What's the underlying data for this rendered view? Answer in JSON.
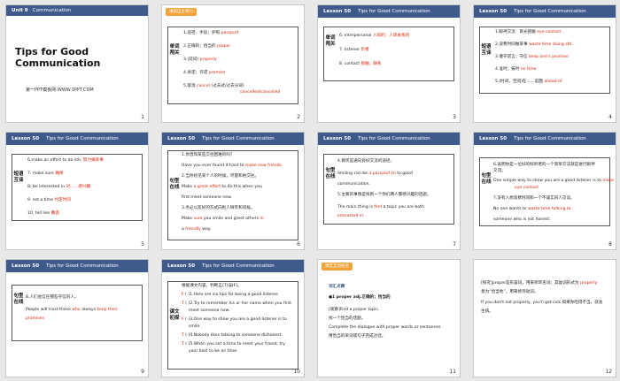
{
  "slides": [
    {
      "num": "1",
      "unit": "Unit 9",
      "header": "Communication",
      "title": "Tips for Good Communication",
      "site": "第一PPT模板网-WWW.1PPT.COM"
    },
    {
      "num": "2",
      "tag": "课前自主预习",
      "lesson": "Lesson 50",
      "header": "Tips for Good Communication",
      "side": "单词闯关",
      "lines": [
        "1.途径、手段；护照",
        "2.正确的；恰当的",
        "3.(前词)",
        "4.承诺；许诺",
        "5.取消",
        "(过去式/过去分词)"
      ],
      "answers": [
        "passport",
        "proper",
        "properly",
        "promise",
        "cancel",
        "cancelled/cancelled"
      ]
    },
    {
      "num": "3",
      "lesson": "Lesson 50",
      "header": "Tips for Good Communication",
      "side": "单词闯关",
      "lines": [
        "6.  interpersonal",
        "7.  listener",
        "8.  contact"
      ],
      "answers": [
        "人际的；人际关系的",
        "听者",
        "接触；联系"
      ]
    },
    {
      "num": "4",
      "lesson": "Lesson 50",
      "header": "Tips for Good Communication",
      "side": "短语互译",
      "lines": [
        "1.眼神交流：目光接触",
        "2.浪费时间做某事",
        "3.遵守诺言；守信",
        "4.准时；按时",
        "5.(时间、空间)在……前面"
      ],
      "answers": [
        "eye contact",
        "waste time doing sth.",
        "keep one's promise",
        "on time",
        "ahead of"
      ]
    },
    {
      "num": "5",
      "lesson": "Lesson 50",
      "header": "Tips for Good Communication",
      "side": "短语互译",
      "lines": [
        "6.make an effort to do sth.",
        "7.  make sure",
        "8.  be interested in",
        "9.  set a time",
        "10.  tell lies"
      ],
      "answers": [
        "努力做某事",
        "确保",
        "对……感兴趣",
        "约定时间",
        "撒谎"
      ]
    },
    {
      "num": "6",
      "lesson": "Lesson 50",
      "header": "Tips for Good Communication",
      "side": "句型在线",
      "lines": [
        "1.你曾和某些交往困难的吗？",
        "Have you ever found it hard to",
        "2.当你初见某个人的时候，尽量和他交往。",
        "Make",
        "to do this when you",
        "first meet someone new.",
        "3.务必以友好的方式向别人微笑和问候。",
        "Make",
        "you smile and greet others",
        "a",
        "way."
      ],
      "answers": [
        "make",
        "new",
        "friends",
        "a",
        "great",
        "effort",
        "sure",
        "in",
        "friendly"
      ]
    },
    {
      "num": "7",
      "lesson": "Lesson 50",
      "header": "Tips for Good Communication",
      "side": "句型在线",
      "lines": [
        "4.微笑是通向良好交流的途径。",
        "Smiling can be",
        "to good",
        "communication.",
        "5.主要的事情是找到一个你们两人都感兴趣的话题。",
        "The main thing is",
        "a topic you are both"
      ],
      "answers": [
        "a",
        "passport",
        "to",
        "find",
        "interested",
        "in"
      ]
    },
    {
      "num": "8",
      "lesson": "Lesson 50",
      "header": "Tips for Good Communication",
      "side": "句型在线",
      "lines": [
        "6.表明你是一位好的倾听者的一个简单方法就是进行眼神",
        "交流。",
        "One simple way to show you are a good listener is to",
        "7.没有人想浪费时间和一个不诚实的人交谈。",
        "No one wants to",
        "someone who is not honest."
      ],
      "answers": [
        "make",
        "eye",
        "contact",
        "waste",
        "time",
        "talking",
        "to"
      ]
    },
    {
      "num": "9",
      "lesson": "Lesson 50",
      "header": "Tips for Good Communication",
      "side": "句型在线",
      "lines": [
        "8.人们会信任那些守信的人。",
        "People will trust those",
        "always"
      ],
      "answers": [
        "who",
        "keep",
        "their",
        "promises"
      ]
    },
    {
      "num": "10",
      "lesson": "Lesson 50",
      "header": "Tips for Good Communication",
      "side": "课文初探",
      "lines": [
        "根据课文内容，判断正(T)误(F)。",
        "(   )1.Here are six tips for being a good listener.",
        "(   )2.Try to remember his or her name when you first",
        "meet someone new.",
        "(   )3.One way to show you are a good listener is to",
        "smile.",
        "(   )4.Nobody likes talking to someone dishonest.",
        "(   )5.When you set a time to meet your friend, try",
        "your best to be on time."
      ],
      "answers": [
        "F",
        "T",
        "F",
        "T",
        "T"
      ]
    },
    {
      "num": "11",
      "tag": "课堂互动探究",
      "lines": [
        "词汇点睛",
        "●1  proper adj.正确的；恰当的",
        "[观察]Find a proper topic.",
        "找一个恰当的话题。",
        "Complete the dialogue with proper words or sentences.",
        "用恰当的单词或句子完成对话。"
      ]
    },
    {
      "num": "12",
      "lines": [
        "[探究]proper是形容词，用来修饰名词；其副词形式为",
        "意为“恰当地”，用来修饰动词。",
        "If you don't eat properly, you'll get sick.如果你吃得不当，就会",
        "生病。"
      ],
      "answers": [
        "properly"
      ]
    }
  ]
}
